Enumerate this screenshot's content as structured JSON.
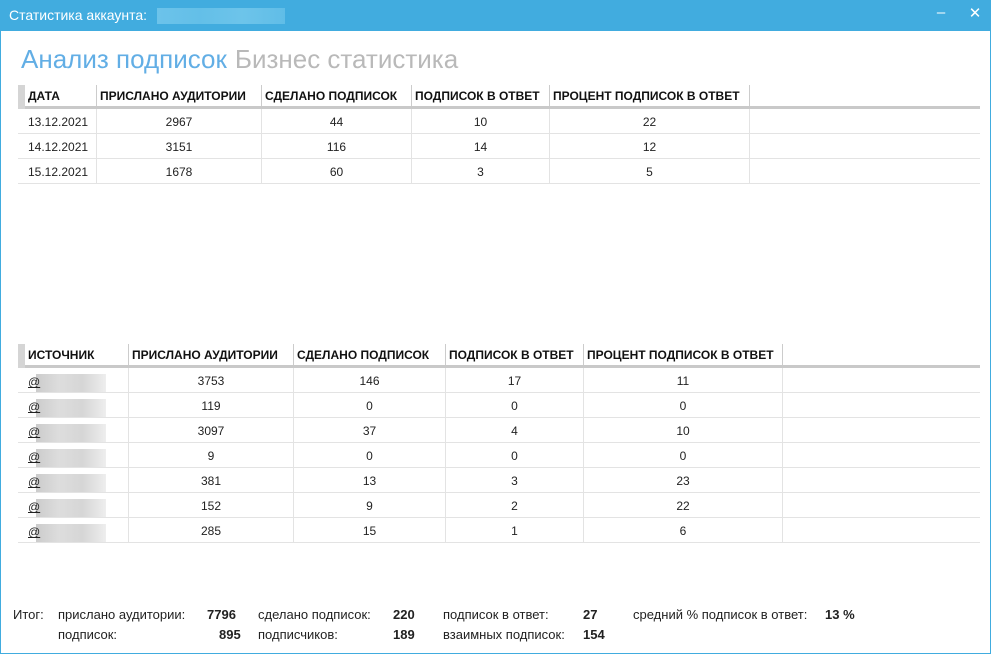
{
  "window": {
    "title": "Статистика аккаунта:",
    "minimize": "–",
    "close": "✕"
  },
  "tabs": [
    {
      "label": "Анализ подписок",
      "active": true
    },
    {
      "label": "Бизнес статистика",
      "active": false
    }
  ],
  "table1": {
    "headers": [
      "ДАТА",
      "ПРИСЛАНО АУДИТОРИИ",
      "СДЕЛАНО ПОДПИСОК",
      "ПОДПИСОК В ОТВЕТ",
      "ПРОЦЕНТ ПОДПИСОК В ОТВЕТ"
    ],
    "rows": [
      [
        "13.12.2021",
        "2967",
        "44",
        "10",
        "22"
      ],
      [
        "14.12.2021",
        "3151",
        "116",
        "14",
        "12"
      ],
      [
        "15.12.2021",
        "1678",
        "60",
        "3",
        "5"
      ]
    ]
  },
  "table2": {
    "headers": [
      "ИСТОЧНИК",
      "ПРИСЛАНО АУДИТОРИИ",
      "СДЕЛАНО ПОДПИСОК",
      "ПОДПИСОК В ОТВЕТ",
      "ПРОЦЕНТ ПОДПИСОК В ОТВЕТ"
    ],
    "rows": [
      [
        "@",
        "3753",
        "146",
        "17",
        "11"
      ],
      [
        "@",
        "119",
        "0",
        "0",
        "0"
      ],
      [
        "@",
        "3097",
        "37",
        "4",
        "10"
      ],
      [
        "@",
        "9",
        "0",
        "0",
        "0"
      ],
      [
        "@",
        "381",
        "13",
        "3",
        "23"
      ],
      [
        "@",
        "152",
        "9",
        "2",
        "22"
      ],
      [
        "@",
        "285",
        "15",
        "1",
        "6"
      ]
    ]
  },
  "totals": {
    "label": "Итог:",
    "sent_label": "прислано аудитории:",
    "sent": "7796",
    "made_label": "сделано подписок:",
    "made": "220",
    "back_label": "подписок в ответ:",
    "back": "27",
    "avg_label": "средний % подписок в ответ:",
    "avg": "13 %",
    "subs_label": "подписок:",
    "subs": "895",
    "followers_label": "подписчиков:",
    "followers": "189",
    "mutual_label": "взаимных подписок:",
    "mutual": "154"
  }
}
